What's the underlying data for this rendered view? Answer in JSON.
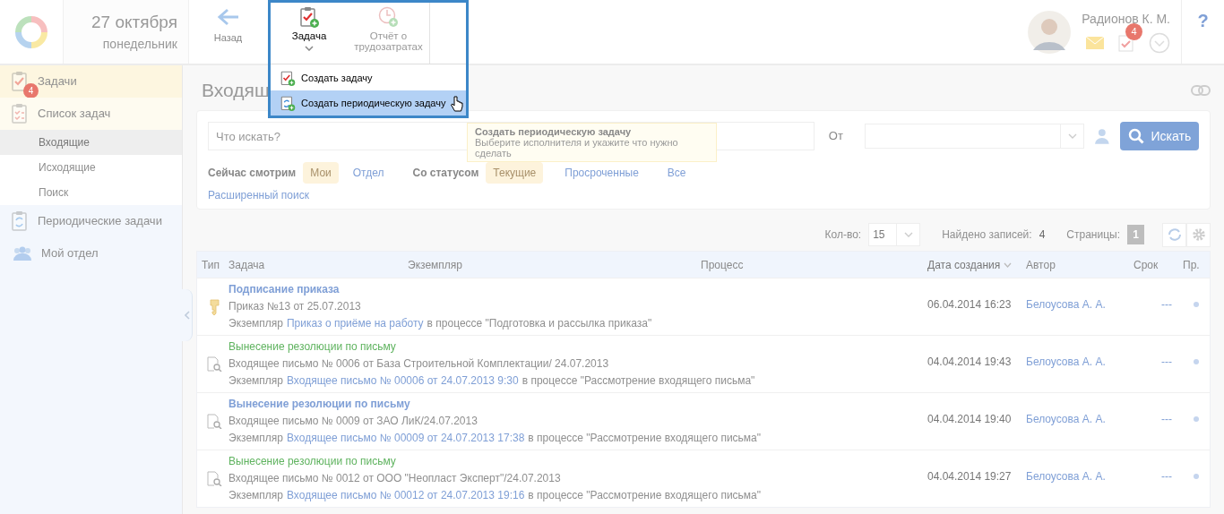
{
  "header": {
    "date": "27 октября",
    "weekday": "понедельник",
    "back": "Назад",
    "user_name": "Радионов К. М.",
    "task_badge": "4",
    "help": "?"
  },
  "create_menu": {
    "buttons": [
      {
        "label": "Задача",
        "selected": true
      },
      {
        "label": "Отчёт о трудозатратах",
        "selected": false
      }
    ],
    "items": [
      {
        "label": "Создать задачу",
        "kind": "task",
        "selected": false
      },
      {
        "label": "Создать периодическую задачу",
        "kind": "periodic",
        "selected": true
      }
    ]
  },
  "tooltip": {
    "title": "Создать периодическую задачу",
    "text": "Выберите исполнителя и укажите что нужно сделать"
  },
  "sidebar": {
    "items": [
      {
        "label": "Задачи",
        "kind": "tasks",
        "badge": "4",
        "selected": true
      },
      {
        "label": "Список задач",
        "kind": "list",
        "selected": true,
        "children": [
          {
            "label": "Входящие",
            "selected": true
          },
          {
            "label": "Исходящие",
            "selected": false
          },
          {
            "label": "Поиск",
            "selected": false
          }
        ]
      },
      {
        "label": "Периодические задачи",
        "kind": "periodic",
        "selected": false
      },
      {
        "label": "Мой отдел",
        "kind": "department",
        "selected": false
      }
    ]
  },
  "page_title": "Входящ",
  "search": {
    "placeholder": "Что искать?",
    "from_label": "От",
    "button": "Искать",
    "view_label": "Сейчас смотрим",
    "view_options": [
      {
        "label": "Мои",
        "selected": true
      },
      {
        "label": "Отдел",
        "selected": false
      }
    ],
    "status_label": "Со статусом",
    "status_options": [
      {
        "label": "Текущие",
        "selected": true
      },
      {
        "label": "Просроченные",
        "selected": false
      },
      {
        "label": "Все",
        "selected": false
      }
    ],
    "advanced": "Расширенный поиск"
  },
  "pager": {
    "count_label": "Кол-во:",
    "count": "15",
    "found_label": "Найдено записей:",
    "found": "4",
    "pages_label": "Страницы:",
    "pages": [
      {
        "label": "1",
        "selected": true
      }
    ]
  },
  "table": {
    "columns": [
      {
        "label": "Тип",
        "sorted": false
      },
      {
        "label": "Задача",
        "sorted": false
      },
      {
        "label": "Экземпляр",
        "sorted": false
      },
      {
        "label": "Процесс",
        "sorted": false
      },
      {
        "label": "Дата создания",
        "sorted": true
      },
      {
        "label": "Автор",
        "sorted": false
      },
      {
        "label": "Срок",
        "sorted": false
      },
      {
        "label": "Пр.",
        "sorted": false
      }
    ],
    "rows": [
      {
        "kind": "order",
        "unread": true,
        "title": "Подписание приказа",
        "subject": "Приказ №13 от 25.07.2013",
        "instance_prefix": "Экземпляр",
        "instance": "Приказ о приёме на работу",
        "process": "в процессе \"Подготовка и рассылка приказа\"",
        "created": "06.04.2014 16:23",
        "author": "Белоусова А. А.",
        "deadline": "---"
      },
      {
        "kind": "letter",
        "unread": false,
        "title": "Вынесение резолюции по письму",
        "subject": "Входящее письмо № 0006 от База Строительной Комплектации/ 24.07.2013",
        "instance_prefix": "Экземпляр",
        "instance": "Входящее письмо № 00006 от 24.07.2013 9:30",
        "process": "в процессе \"Рассмотрение входящего письма\"",
        "created": "04.04.2014 19:43",
        "author": "Белоусова А. А.",
        "deadline": "---"
      },
      {
        "kind": "letter",
        "unread": true,
        "title": "Вынесение резолюции по письму",
        "subject": "Входящее письмо № 0009 от ЗАО ЛиК/24.07.2013",
        "instance_prefix": "Экземпляр",
        "instance": "Входящее письмо № 00009 от 24.07.2013 17:38",
        "process": "в процессе \"Рассмотрение входящего письма\"",
        "created": "04.04.2014 19:40",
        "author": "Белоусова А. А.",
        "deadline": "---"
      },
      {
        "kind": "letter",
        "unread": false,
        "title": "Вынесение резолюции по письму",
        "subject": "Входящее письмо № 0012 от ООО \"Неопласт Эксперт\"/24.07.2013",
        "instance_prefix": "Экземпляр",
        "instance": "Входящее письмо № 00012 от 24.07.2013 19:16",
        "process": "в процессе \"Рассмотрение входящего письма\"",
        "created": "04.04.2014 19:27",
        "author": "Белоусова А. А.",
        "deadline": "---"
      }
    ]
  }
}
